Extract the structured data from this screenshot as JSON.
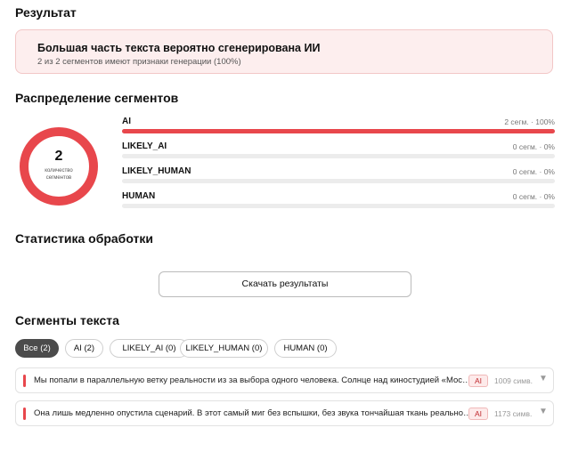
{
  "result": {
    "heading": "Результат",
    "title": "Большая часть текста вероятно сгенерирована ИИ",
    "subtitle": "2 из 2 сегментов имеют признаки генерации (100%)"
  },
  "distribution": {
    "heading": "Распределение сегментов",
    "donut": {
      "count": "2",
      "label": "количество сегментов",
      "color": "#e8474c"
    },
    "rows": [
      {
        "name": "AI",
        "value": "2 сегм. · 100%",
        "fraction": 1.0
      },
      {
        "name": "LIKELY_AI",
        "value": "0 сегм. · 0%",
        "fraction": 0
      },
      {
        "name": "LIKELY_HUMAN",
        "value": "0 сегм. · 0%",
        "fraction": 0
      },
      {
        "name": "HUMAN",
        "value": "0 сегм. · 0%",
        "fraction": 0
      }
    ]
  },
  "stats": {
    "heading": "Статистика обработки",
    "download_label": "Скачать результаты"
  },
  "segments": {
    "heading": "Сегменты текста",
    "filters": [
      {
        "label": "Все (2)",
        "active": true
      },
      {
        "label": "AI (2)",
        "active": false
      },
      {
        "label": "LIKELY_AI (0)",
        "active": false
      },
      {
        "label": "LIKELY_HUMAN (0)",
        "active": false
      },
      {
        "label": "HUMAN (0)",
        "active": false
      }
    ],
    "items": [
      {
        "text": "Мы попали в параллельную ветку реальности из за выбора одного человека. Солнце над киностудией «Мосфильм» светило",
        "badge": "AI",
        "length": "1009 симв."
      },
      {
        "text": "Она лишь медленно опустила сценарий. В этот самый миг без вспышки, без звука тончайшая ткань реальности",
        "badge": "AI",
        "length": "1173 симв."
      }
    ]
  },
  "colors": {
    "accent": "#e8474c",
    "accent_bg": "#fdeeee",
    "chip_active": "#4b4b4b"
  },
  "icons": {
    "segment_caret": "chevron-down-icon"
  }
}
